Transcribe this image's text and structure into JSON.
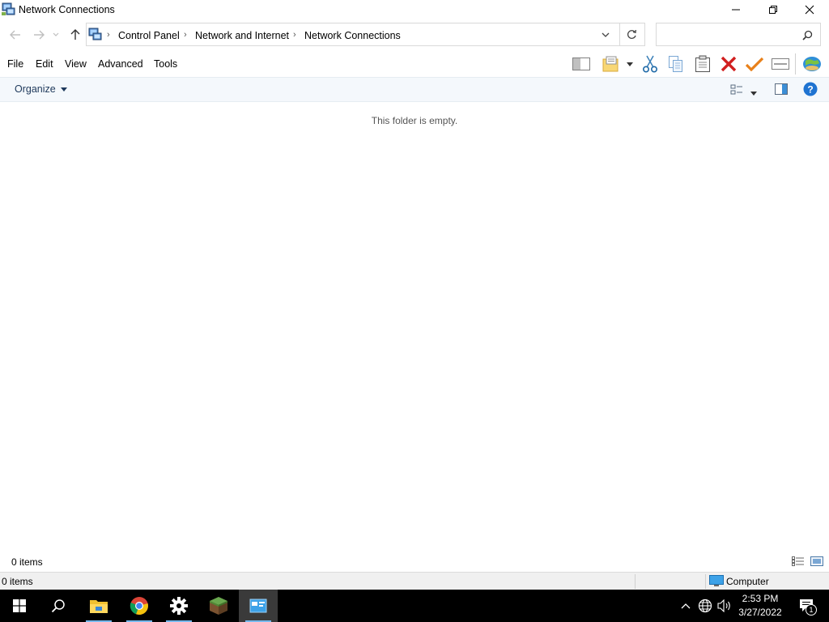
{
  "window": {
    "title": "Network Connections",
    "controls": {
      "minimize": "minimize-icon",
      "maximize": "restore-icon",
      "close": "close-icon"
    }
  },
  "nav": {
    "breadcrumb": [
      "Control Panel",
      "Network and Internet",
      "Network Connections"
    ],
    "search_placeholder": ""
  },
  "menu": {
    "items": [
      "File",
      "Edit",
      "View",
      "Advanced",
      "Tools"
    ]
  },
  "toolbar": {
    "icons": [
      "layout-icon",
      "folder-view-icon",
      "cut-icon",
      "copy-icon",
      "paste-icon",
      "delete-icon",
      "check-icon",
      "properties-icon",
      "globe-icon"
    ]
  },
  "command_bar": {
    "organize_label": "Organize"
  },
  "content": {
    "empty_message": "This folder is empty."
  },
  "inner_status": {
    "item_count": "0 items"
  },
  "status_bar": {
    "item_count": "0 items",
    "location": "Computer"
  },
  "taskbar": {
    "apps": [
      "start-icon",
      "search-icon",
      "file-explorer-icon",
      "chrome-icon",
      "settings-icon",
      "minecraft-icon",
      "control-panel-icon"
    ],
    "time": "2:53 PM",
    "date": "3/27/2022",
    "notification_count": "1"
  },
  "colors": {
    "accent": "#0078d7",
    "command_bar_bg": "#f4f8fc",
    "taskbar_bg": "#000000",
    "delete_red": "#d11f1f",
    "check_orange": "#e8801a"
  }
}
